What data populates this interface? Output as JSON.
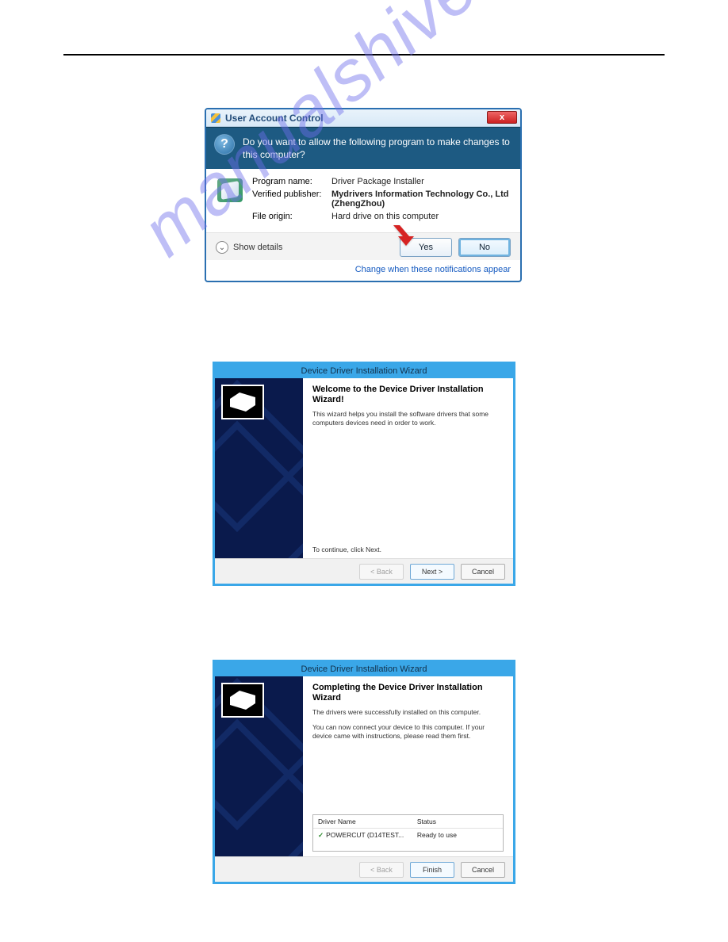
{
  "watermark": "manualshive.com",
  "uac": {
    "title": "User Account Control",
    "close_glyph": "x",
    "prompt": "Do you want to allow the following program to make changes to this computer?",
    "labels": {
      "program": "Program name:",
      "publisher": "Verified publisher:",
      "origin": "File origin:"
    },
    "values": {
      "program": "Driver Package Installer",
      "publisher": "Mydrivers Information Technology Co., Ltd (ZhengZhou)",
      "origin": "Hard drive on this computer"
    },
    "show_details": "Show details",
    "yes": "Yes",
    "no": "No",
    "change_link": "Change when these notifications appear"
  },
  "wizard_a": {
    "title": "Device Driver Installation Wizard",
    "heading": "Welcome to the Device Driver Installation Wizard!",
    "text": "This wizard helps you install the software drivers that some computers devices need in order to work.",
    "continue": "To continue, click Next.",
    "back": "< Back",
    "next": "Next >",
    "cancel": "Cancel"
  },
  "wizard_b": {
    "title": "Device Driver Installation Wizard",
    "heading": "Completing the Device Driver Installation Wizard",
    "text1": "The drivers were successfully installed on this computer.",
    "text2": "You can now connect your device to this computer. If your device came with instructions, please read them first.",
    "col_driver": "Driver Name",
    "col_status": "Status",
    "row_driver": "POWERCUT (D14TEST...",
    "row_status": "Ready to use",
    "back": "< Back",
    "finish": "Finish",
    "cancel": "Cancel"
  }
}
